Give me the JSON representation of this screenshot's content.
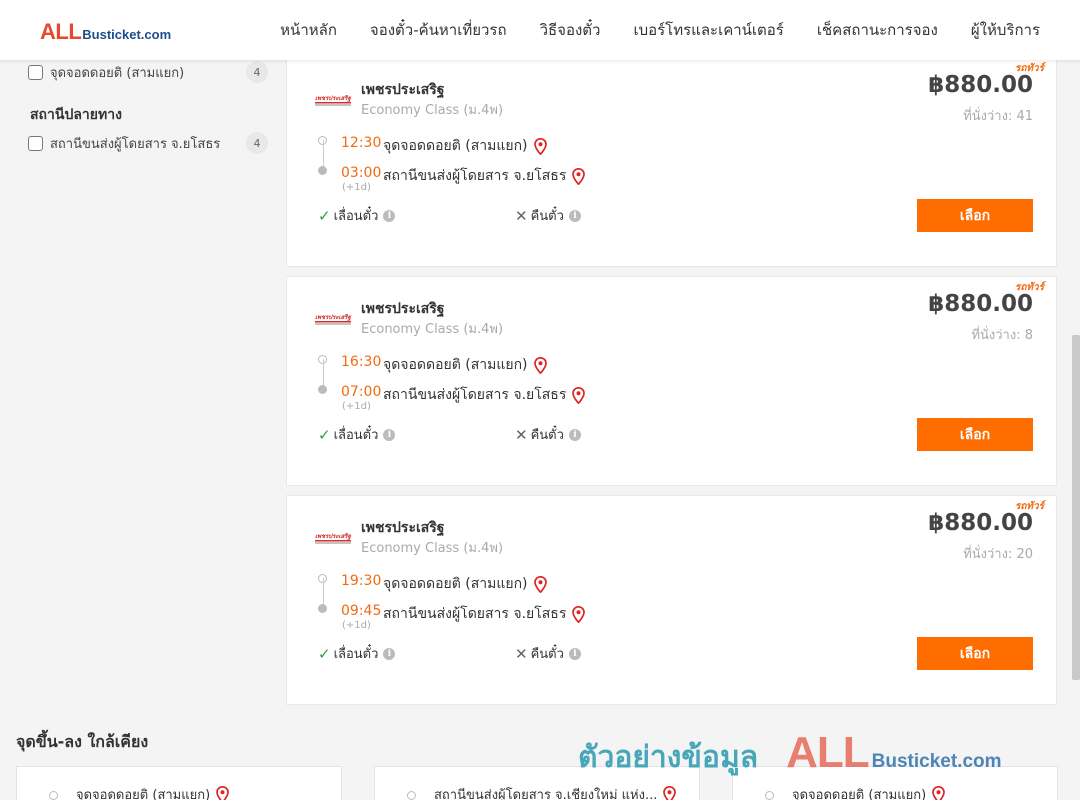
{
  "header": {
    "logo_all": "ALL",
    "logo_busticket": "Busticket.com",
    "nav": [
      "หน้าหลัก",
      "จองตั๋ว-ค้นหาเที่ยวรถ",
      "วิธีจองตั๋ว",
      "เบอร์โทรและเคาน์เตอร์",
      "เช็คสถานะการจอง",
      "ผู้ให้บริการ"
    ]
  },
  "sidebar": {
    "origin_item": {
      "label": "จุดจอดดอยติ (สามแยก)",
      "count": "4"
    },
    "destination_heading": "สถานีปลายทาง",
    "destination_item": {
      "label": "สถานีขนส่งผู้โดยสาร จ.ยโสธร",
      "count": "4"
    }
  },
  "trips": [
    {
      "tag": "รถทัวร์",
      "operator": "เพชรประเสริฐ",
      "class": "Economy Class (ม.4พ)",
      "price": "฿880.00",
      "seats": "ที่นั่งว่าง: 41",
      "depart_time": "12:30",
      "depart_stop": "จุดจอดดอยติ (สามแยก)",
      "arrive_time": "03:00",
      "arrive_stop": "สถานีขนส่งผู้โดยสาร จ.ยโสธร",
      "plus_day": "(+1d)",
      "reschedule": "เลื่อนตั๋ว",
      "refund": "คืนตั๋ว",
      "button": "เลือก"
    },
    {
      "tag": "รถทัวร์",
      "operator": "เพชรประเสริฐ",
      "class": "Economy Class (ม.4พ)",
      "price": "฿880.00",
      "seats": "ที่นั่งว่าง: 8",
      "depart_time": "16:30",
      "depart_stop": "จุดจอดดอยติ (สามแยก)",
      "arrive_time": "07:00",
      "arrive_stop": "สถานีขนส่งผู้โดยสาร จ.ยโสธร",
      "plus_day": "(+1d)",
      "reschedule": "เลื่อนตั๋ว",
      "refund": "คืนตั๋ว",
      "button": "เลือก"
    },
    {
      "tag": "รถทัวร์",
      "operator": "เพชรประเสริฐ",
      "class": "Economy Class (ม.4พ)",
      "price": "฿880.00",
      "seats": "ที่นั่งว่าง: 20",
      "depart_time": "19:30",
      "depart_stop": "จุดจอดดอยติ (สามแยก)",
      "arrive_time": "09:45",
      "arrive_stop": "สถานีขนส่งผู้โดยสาร จ.ยโสธร",
      "plus_day": "(+1d)",
      "reschedule": "เลื่อนตั๋ว",
      "refund": "คืนตั๋ว",
      "button": "เลือก"
    }
  ],
  "nearby": {
    "title": "จุดขึ้น-ลง ใกล้เคียง",
    "items": [
      "จุดจอดดอยติ (สามแยก)",
      "สถานีขนส่งผู้โดยสาร จ.เชียงใหม่ แห่ง...",
      "จุดจอดดอยติ (สามแยก)"
    ]
  },
  "watermark": {
    "text": "ตัวอย่างข้อมูล",
    "all": "ALL",
    "busticket": "Busticket.com"
  },
  "colors": {
    "accent": "#ff6c00",
    "time": "#f26a10",
    "check": "#2e9e3e",
    "pin": "#e02424"
  },
  "icons": [
    "map-pin-icon",
    "check-icon",
    "cross-icon",
    "info-icon",
    "checkbox-icon"
  ]
}
